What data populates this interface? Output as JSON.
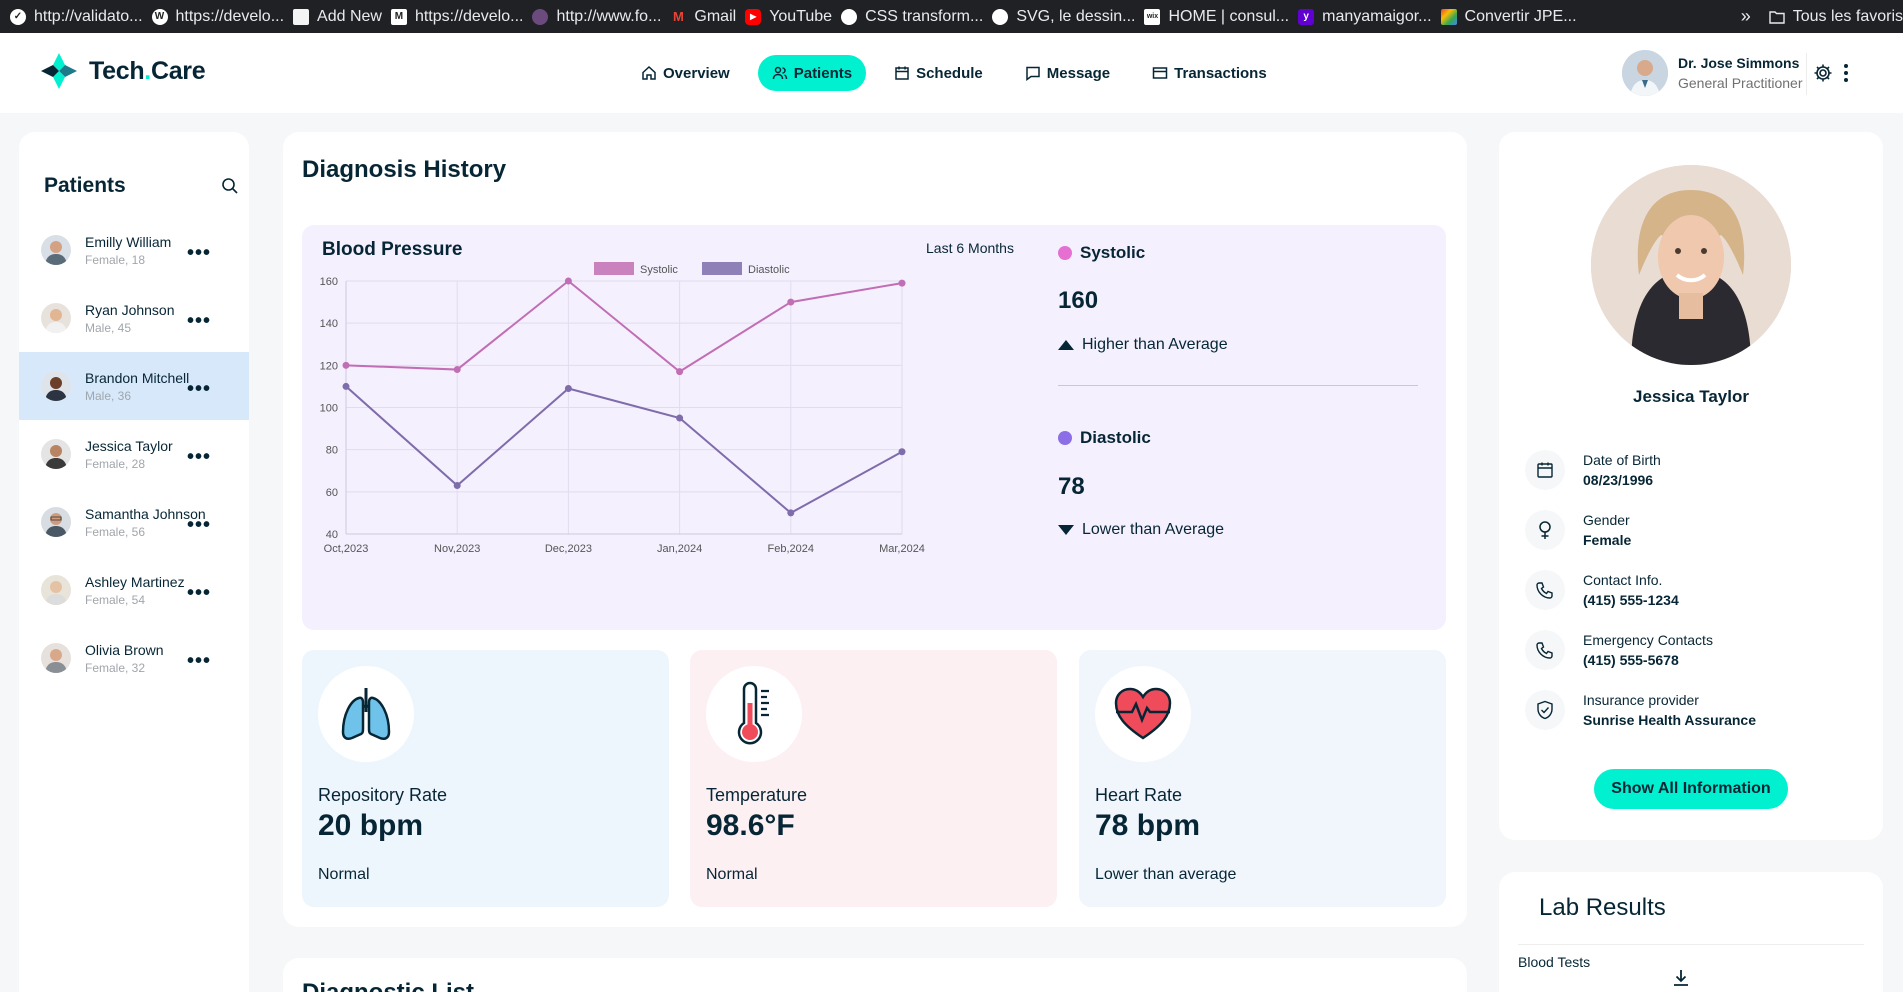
{
  "bookmarks": [
    {
      "label": "http://validato...",
      "color": "#ffffff"
    },
    {
      "label": "https://develo...",
      "color": "#ffffff"
    },
    {
      "label": "Add New",
      "color": "#f4f4f4"
    },
    {
      "label": "https://develo...",
      "color": "#ffffff"
    },
    {
      "label": "http://www.fo...",
      "color": "#6b4b7e"
    },
    {
      "label": "Gmail",
      "color": "#ea4335"
    },
    {
      "label": "YouTube",
      "color": "#ff0000"
    },
    {
      "label": "CSS transform...",
      "color": "#ffffff"
    },
    {
      "label": "SVG, le dessin...",
      "color": "#ffffff"
    },
    {
      "label": "HOME | consul...",
      "color": "#ffffff"
    },
    {
      "label": "manyamaigor...",
      "color": "#6001d2"
    },
    {
      "label": "Convertir JPE...",
      "color": "#f4b400"
    }
  ],
  "bookmarks_more": "»",
  "bookmarks_folder": "Tous les favoris",
  "brand": {
    "name_a": "Tech",
    "name_dot": ".",
    "name_b": "Care",
    "accent": "#01f0d0"
  },
  "nav": [
    {
      "label": "Overview",
      "icon": "home-icon"
    },
    {
      "label": "Patients",
      "icon": "users-icon",
      "active": true
    },
    {
      "label": "Schedule",
      "icon": "calendar-icon"
    },
    {
      "label": "Message",
      "icon": "message-icon"
    },
    {
      "label": "Transactions",
      "icon": "credit-card-icon"
    }
  ],
  "doctor": {
    "name": "Dr. Jose Simmons",
    "role": "General Practitioner"
  },
  "patients": {
    "title": "Patients",
    "list": [
      {
        "name": "Emilly William",
        "meta": "Female, 18"
      },
      {
        "name": "Ryan Johnson",
        "meta": "Male, 45"
      },
      {
        "name": "Brandon Mitchell",
        "meta": "Male, 36",
        "active": true
      },
      {
        "name": "Jessica Taylor",
        "meta": "Female, 28"
      },
      {
        "name": "Samantha Johnson",
        "meta": "Female, 56"
      },
      {
        "name": "Ashley Martinez",
        "meta": "Female, 54"
      },
      {
        "name": "Olivia Brown",
        "meta": "Female, 32"
      }
    ]
  },
  "diagnosis": {
    "title": "Diagnosis History",
    "bp_title": "Blood Pressure",
    "range": "Last 6 Months",
    "systolic": {
      "label": "Systolic",
      "value": "160",
      "compare": "Higher than Average",
      "color": "#e66fd2"
    },
    "diastolic": {
      "label": "Diastolic",
      "value": "78",
      "compare": "Lower than Average",
      "color": "#8c6fe6"
    },
    "cards": [
      {
        "label": "Repository Rate",
        "value": "20 bpm",
        "status": "Normal",
        "bg": "#e0f3fa",
        "icon": "lungs-icon"
      },
      {
        "label": "Temperature",
        "value": "98.6°F",
        "status": "Normal",
        "bg": "#ffe6e9",
        "icon": "thermometer-icon"
      },
      {
        "label": "Heart Rate",
        "value": "78 bpm",
        "status": "Lower than average",
        "bg": "#ffe6f1",
        "icon": "heart-icon"
      }
    ],
    "list_title": "Diagnostic List"
  },
  "chart_data": {
    "type": "line",
    "categories": [
      "Oct,2023",
      "Nov,2023",
      "Dec,2023",
      "Jan,2024",
      "Feb,2024",
      "Mar,2024"
    ],
    "series": [
      {
        "name": "Systolic",
        "values": [
          120,
          118,
          160,
          117,
          150,
          159
        ],
        "color": "#c26eb4"
      },
      {
        "name": "Diastolic",
        "values": [
          110,
          63,
          109,
          95,
          50,
          79
        ],
        "color": "#7e6cab"
      }
    ],
    "ylim": [
      40,
      160
    ],
    "yticks": [
      40,
      60,
      80,
      100,
      120,
      140,
      160
    ],
    "grid": true,
    "legend": "top"
  },
  "profile": {
    "name": "Jessica Taylor",
    "fields": [
      {
        "label": "Date of Birth",
        "value": "08/23/1996",
        "icon": "calendar-icon"
      },
      {
        "label": "Gender",
        "value": "Female",
        "icon": "female-icon"
      },
      {
        "label": "Contact Info.",
        "value": "(415) 555-1234",
        "icon": "phone-icon"
      },
      {
        "label": "Emergency Contacts",
        "value": "(415) 555-5678",
        "icon": "phone-icon"
      },
      {
        "label": "Insurance provider",
        "value": "Sunrise Health Assurance",
        "icon": "shield-icon"
      }
    ],
    "button": "Show All Information"
  },
  "lab": {
    "title": "Lab Results",
    "items": [
      "Blood Tests"
    ]
  }
}
